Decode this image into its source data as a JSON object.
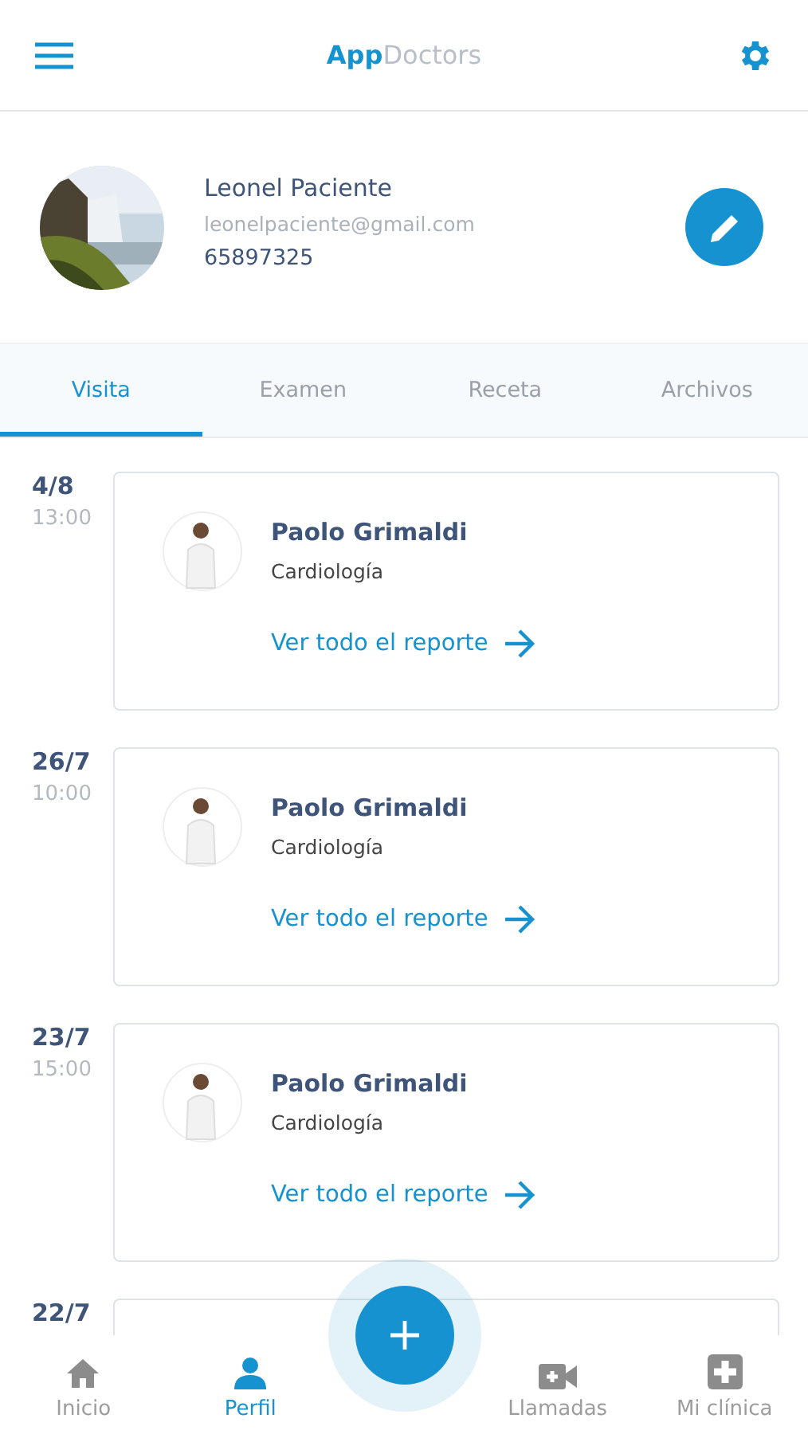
{
  "header": {
    "logo_bold": "App",
    "logo_light": "Doctors"
  },
  "profile": {
    "name": "Leonel Paciente",
    "email": "leonelpaciente@gmail.com",
    "phone": "65897325"
  },
  "tabs": [
    {
      "label": "Visita",
      "selected": true
    },
    {
      "label": "Examen",
      "selected": false
    },
    {
      "label": "Receta",
      "selected": false
    },
    {
      "label": "Archivos",
      "selected": false
    }
  ],
  "visits": [
    {
      "date": "4/8",
      "time": "13:00",
      "doctor": "Paolo Grimaldi",
      "specialty": "Cardiología",
      "link": "Ver todo el reporte"
    },
    {
      "date": "26/7",
      "time": "10:00",
      "doctor": "Paolo Grimaldi",
      "specialty": "Cardiología",
      "link": "Ver todo el reporte"
    },
    {
      "date": "23/7",
      "time": "15:00",
      "doctor": "Paolo Grimaldi",
      "specialty": "Cardiología",
      "link": "Ver todo el reporte"
    },
    {
      "date": "22/7"
    }
  ],
  "nav": [
    {
      "kind": "home",
      "label": "Inicio",
      "selected": false
    },
    {
      "kind": "person",
      "label": "Perfil",
      "selected": true
    },
    {
      "kind": "video",
      "label": "Llamadas",
      "selected": false
    },
    {
      "kind": "clinic",
      "label": "Mi clínica",
      "selected": false
    }
  ]
}
